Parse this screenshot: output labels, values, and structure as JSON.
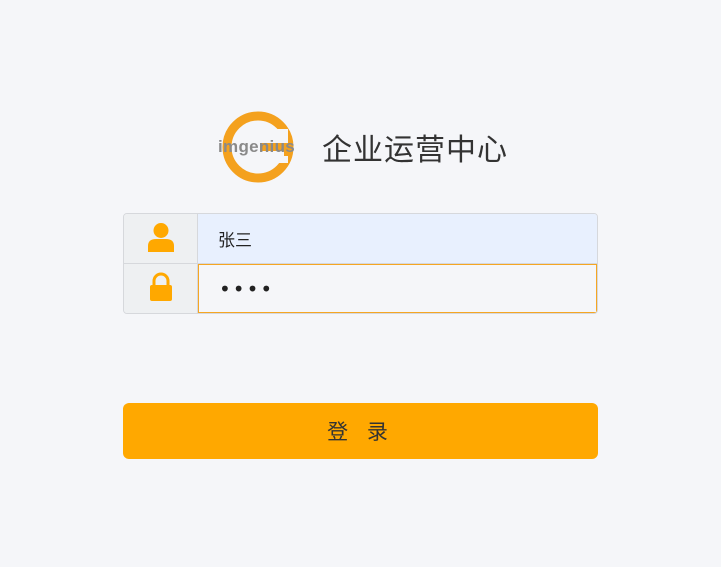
{
  "brand": {
    "logo_text": "imgenius",
    "title": "企业运营中心",
    "accent_color": "#ffa800"
  },
  "form": {
    "username": {
      "icon": "user-icon",
      "value": "张三"
    },
    "password": {
      "icon": "lock-icon",
      "value": "abcd"
    }
  },
  "actions": {
    "login_label": "登 录"
  }
}
